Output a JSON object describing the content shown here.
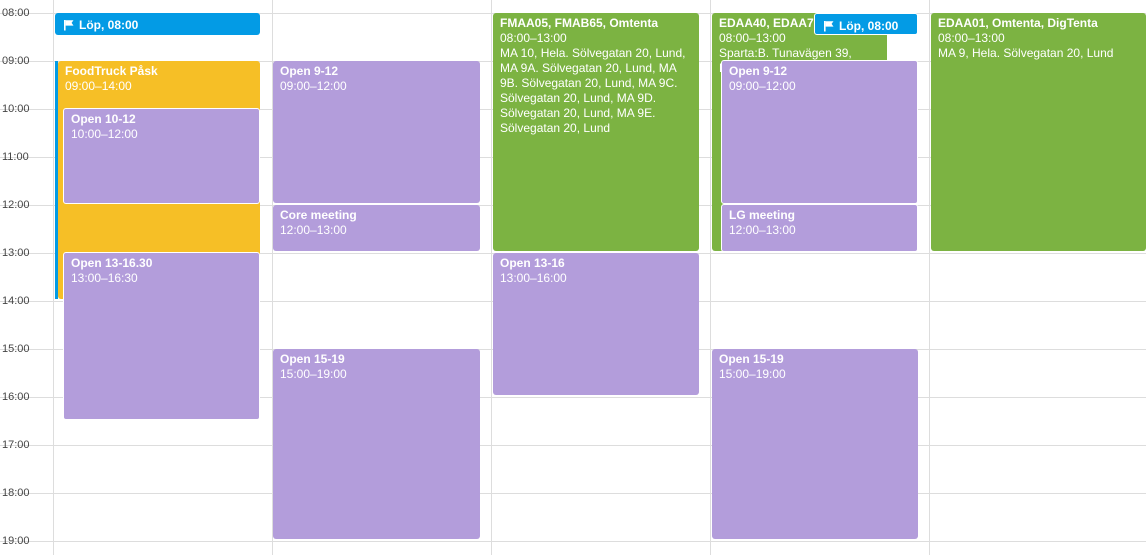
{
  "time_labels": [
    "08:00",
    "09:00",
    "10:00",
    "11:00",
    "12:00",
    "13:00",
    "14:00",
    "15:00",
    "16:00",
    "17:00",
    "18:00",
    "19:00"
  ],
  "colors": {
    "purple": "#b39ddb",
    "green": "#7cb342",
    "yellow": "#f6bf26",
    "blue": "#039be5",
    "grid": "#dddddd"
  },
  "chips": [
    {
      "label": "Löp, 08:00",
      "color": "blue",
      "icon": "flag-icon"
    },
    {
      "label": "Löp, 08:00",
      "color": "blue",
      "icon": "flag-icon"
    }
  ],
  "events": [
    {
      "title": "FoodTruck Påsk",
      "time": "09:00–14:00",
      "color": "yellow"
    },
    {
      "title": "Open 10-12",
      "time": "10:00–12:00",
      "color": "purple"
    },
    {
      "title": "Open 13-16.30",
      "time": "13:00–16:30",
      "color": "purple"
    },
    {
      "title": "Open 9-12",
      "time": "09:00–12:00",
      "color": "purple"
    },
    {
      "title": "Core meeting",
      "time": "12:00–13:00",
      "color": "purple"
    },
    {
      "title": "Open 15-19",
      "time": "15:00–19:00",
      "color": "purple"
    },
    {
      "title": "FMAA05, FMAB65, Omtenta",
      "time": "08:00–13:00",
      "location": "MA 10, Hela. Sölvegatan 20, Lund, MA 9A. Sölvegatan 20, Lund, MA 9B. Sölvegatan 20, Lund, MA 9C. Sölvegatan 20, Lund, MA 9D. Sölvegatan 20, Lund, MA 9E. Sölvegatan 20, Lund",
      "color": "green"
    },
    {
      "title": "Open 13-16",
      "time": "13:00–16:00",
      "color": "purple"
    },
    {
      "title": "EDAA40, EDAA75",
      "time": "08:00–13:00",
      "location": "Sparta:B. Tunavägen 39, Lund",
      "color": "green"
    },
    {
      "title": "Open 9-12",
      "time": "09:00–12:00",
      "color": "purple"
    },
    {
      "title": "LG meeting",
      "time": "12:00–13:00",
      "color": "purple"
    },
    {
      "title": "Open 15-19",
      "time": "15:00–19:00",
      "color": "purple"
    },
    {
      "title": "EDAA01, Omtenta, DigTenta",
      "time": "08:00–13:00",
      "location": "MA 9, Hela. Sölvegatan 20, Lund",
      "color": "green"
    }
  ]
}
